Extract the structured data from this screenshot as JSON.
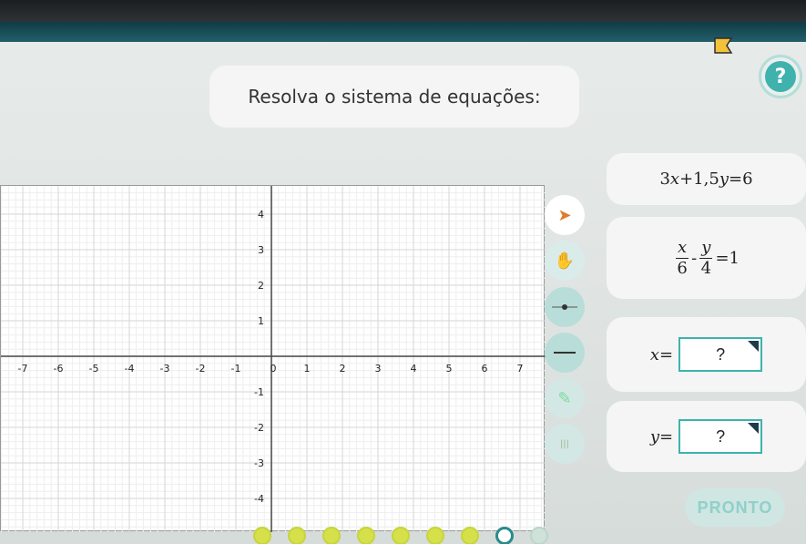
{
  "instruction": "Resolva o sistema de equações:",
  "graph": {
    "x_ticks": [
      "-7",
      "-6",
      "-5",
      "-4",
      "-3",
      "-2",
      "-1",
      "0",
      "1",
      "2",
      "3",
      "4",
      "5",
      "6",
      "7"
    ],
    "y_ticks_pos": [
      "4",
      "3",
      "2",
      "1"
    ],
    "y_ticks_neg": [
      "-1",
      "-2",
      "-3",
      "-4"
    ]
  },
  "tools": {
    "pointer_icon": "cursor-arrow-icon",
    "hand_icon": "hand-pan-icon",
    "point_icon": "point-tool-icon",
    "line_icon": "line-tool-icon",
    "eraser_icon": "eraser-icon",
    "extra_icon": "more-icon"
  },
  "equations": {
    "eq1": {
      "a": "3",
      "x": "x",
      "plus": "+",
      "b": "1,5",
      "y": "y",
      "eq": "=",
      "rhs": "6"
    },
    "eq2": {
      "x": "x",
      "den1": "6",
      "minus": "-",
      "y": "y",
      "den2": "4",
      "eq": "=",
      "rhs": "1"
    }
  },
  "answers": {
    "x_label": "x",
    "x_eq": "=",
    "x_value": "?",
    "y_label": "y",
    "y_eq": "=",
    "y_value": "?"
  },
  "done_button": "PRONTO",
  "progress": {
    "completed": 7,
    "current": 8,
    "total": 9
  },
  "colors": {
    "accent": "#3cb3ad",
    "progress_done": "#d5e04a",
    "topbar": "#0f3b45"
  }
}
